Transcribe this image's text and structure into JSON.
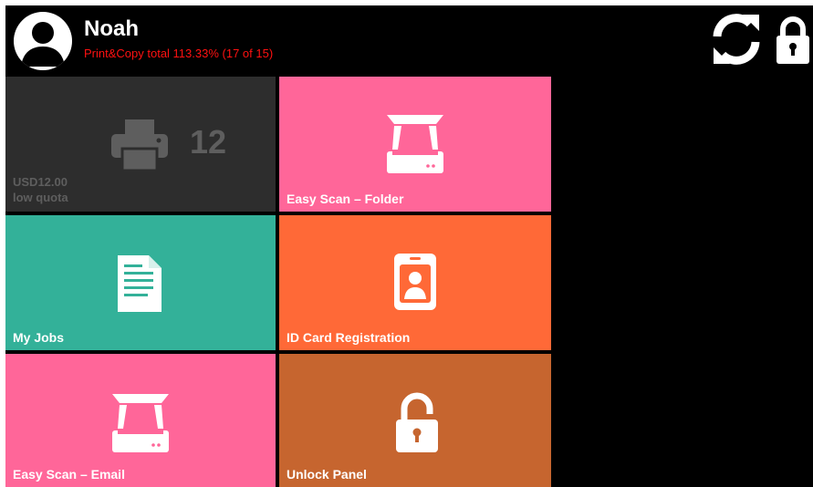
{
  "user": {
    "name": "Noah",
    "quota_summary": "Print&Copy total 113.33% (17 of 15)"
  },
  "header": {
    "refresh_icon": "refresh-icon",
    "lock_icon": "lock-icon"
  },
  "tiles": {
    "printer": {
      "count": "12",
      "balance": "USD12.00",
      "status": "low quota",
      "icon": "printer-icon"
    },
    "scan_folder": {
      "label": "Easy Scan – Folder",
      "icon": "scanner-icon"
    },
    "my_jobs": {
      "label": "My Jobs",
      "icon": "document-icon"
    },
    "id_card": {
      "label": "ID Card Registration",
      "icon": "id-card-icon"
    },
    "scan_email": {
      "label": "Easy Scan – Email",
      "icon": "scanner-icon"
    },
    "unlock_panel": {
      "label": "Unlock Panel",
      "icon": "unlock-icon"
    }
  },
  "colors": {
    "background": "#000000",
    "printer_tile": "#2d2d2d",
    "scan_tile": "#ff6699",
    "jobs_tile": "#33b199",
    "id_card_tile": "#ff6937",
    "unlock_tile": "#c6652f",
    "quota_text": "#ff1111"
  }
}
